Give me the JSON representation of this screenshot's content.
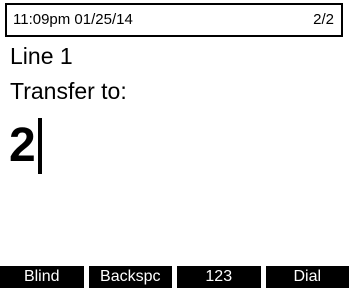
{
  "status": {
    "time_date": "11:09pm  01/25/14",
    "page": "2/2"
  },
  "call": {
    "line": "Line 1",
    "prompt": "Transfer to:",
    "entry": "2"
  },
  "softkeys": [
    {
      "label": "Blind"
    },
    {
      "label": "Backspc"
    },
    {
      "label": "123"
    },
    {
      "label": "Dial"
    }
  ],
  "colors": {
    "background": "#ffffff",
    "text": "#000000",
    "softkey_bg": "#000000",
    "softkey_text": "#ffffff"
  }
}
